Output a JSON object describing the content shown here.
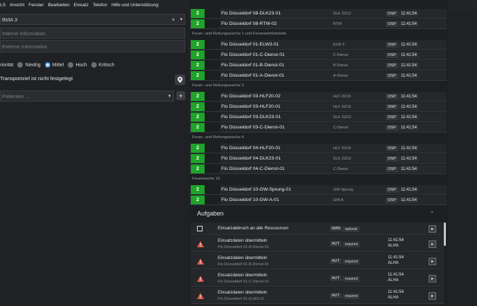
{
  "menu": [
    "LS",
    "Ansicht",
    "Fenster",
    "Bearbeiten",
    "Einsatz",
    "Telefon",
    "Hilfe und Unterstützung"
  ],
  "left": {
    "keyword_value": "BMA 3",
    "internal_placeholder": "Interne Information",
    "external_placeholder": "Externe Information",
    "priority_label": "riorität",
    "priorities": [
      "Niedrig",
      "Mittel",
      "Hoch",
      "Kritisch"
    ],
    "priority_selected": "Mittel",
    "transport_text": "Transportziel ist nicht festgelegt",
    "patients_placeholder": "Patienten ..."
  },
  "groups": {
    "fw1": "Feuer- und Rettungswache 1 und Feuerwehrleitstelle",
    "fw3": "Feuer- und Rettungswache 3",
    "fw4": "Feuer- und Rettungswache 4",
    "fw10": "Feuerwache 10"
  },
  "resources": [
    {
      "status": "2",
      "name": "Flo Düsseldorf 08-DLK23-01",
      "type": "DLK 23/12",
      "dsp": "DSP",
      "time": "11:41:54"
    },
    {
      "status": "2",
      "name": "Flo Düsseldorf 08-RTW-02",
      "type": "RTW",
      "dsp": "DSP",
      "time": "11:41:54"
    },
    {
      "status": "2",
      "name": "Flo Düsseldorf 01-ELW3-01",
      "type": "ELW 3",
      "dsp": "DSP",
      "time": "11:41:54"
    },
    {
      "status": "2",
      "name": "Flo Düsseldorf 01-C-Dienst-01",
      "type": "C-Dienst",
      "dsp": "DSP",
      "time": "11:41:54"
    },
    {
      "status": "2",
      "name": "Flo Düsseldorf 01-B-Dienst-01",
      "type": "B-Dienst",
      "dsp": "DSP",
      "time": "11:41:54"
    },
    {
      "status": "2",
      "name": "Flo Düsseldorf 01-A-Dienst-01",
      "type": "A-Dienst",
      "dsp": "DSP",
      "time": "11:41:54"
    },
    {
      "status": "2",
      "name": "Flo Düsseldorf 03-HLF20-02",
      "type": "HLF 20/16",
      "dsp": "DSP",
      "time": "11:41:54"
    },
    {
      "status": "2",
      "name": "Flo Düsseldorf 03-HLF20-01",
      "type": "HLF 20/16",
      "dsp": "DSP",
      "time": "11:41:54"
    },
    {
      "status": "2",
      "name": "Flo Düsseldorf 03-DLK23-01",
      "type": "DLK 23/12",
      "dsp": "DSP",
      "time": "11:41:54"
    },
    {
      "status": "2",
      "name": "Flo Düsseldorf 03-C-Dienst-01",
      "type": "C-Dienst",
      "dsp": "DSP",
      "time": "11:41:54"
    },
    {
      "status": "2",
      "name": "Flo Düsseldorf 04-HLF20-01",
      "type": "HLF 20/16",
      "dsp": "DSP",
      "time": "11:41:54"
    },
    {
      "status": "2",
      "name": "Flo Düsseldorf 04-DLK23-01",
      "type": "DLK 23/12",
      "dsp": "DSP",
      "time": "11:41:54"
    },
    {
      "status": "2",
      "name": "Flo Düsseldorf 04-C-Dienst-01",
      "type": "C-Dienst",
      "dsp": "DSP",
      "time": "11:41:54"
    },
    {
      "status": "2",
      "name": "Flo Düsseldorf 10-GW-Sprung-01",
      "type": "GW-Sprung",
      "dsp": "DSP",
      "time": "11:41:54"
    },
    {
      "status": "2",
      "name": "Flo Düsseldorf 10-GW-A-01",
      "type": "GW-A",
      "dsp": "DSP",
      "time": "11:41:54"
    }
  ],
  "aufgaben": {
    "title": "Aufgaben",
    "tasks": [
      {
        "title": "Einsatzabbruch an alle Ressourcen",
        "sub": "",
        "mode": "MAN",
        "req": "optional",
        "time": "",
        "user": ""
      },
      {
        "title": "Einsatzdaten übermitteln",
        "sub": "Flo Düsseldorf 01-A-Dienst-01",
        "mode": "AUT",
        "req": "required",
        "time": "11:41:54",
        "user": "ALHA"
      },
      {
        "title": "Einsatzdaten übermitteln",
        "sub": "Flo Düsseldorf 01-B-Dienst-01",
        "mode": "AUT",
        "req": "required",
        "time": "11:41:54",
        "user": "ALHA"
      },
      {
        "title": "Einsatzdaten übermitteln",
        "sub": "Flo Düsseldorf 01-C-Dienst-01",
        "mode": "AUT",
        "req": "required",
        "time": "11:41:54",
        "user": "ALHA"
      },
      {
        "title": "Einsatzdaten übermitteln",
        "sub": "Flo Düsseldorf 01-ELW3-01",
        "mode": "AUT",
        "req": "required",
        "time": "11:41:54",
        "user": "ALHA"
      }
    ]
  },
  "colors": {
    "status_green": "#1fa32a",
    "warning_red": "#e05a4a"
  }
}
